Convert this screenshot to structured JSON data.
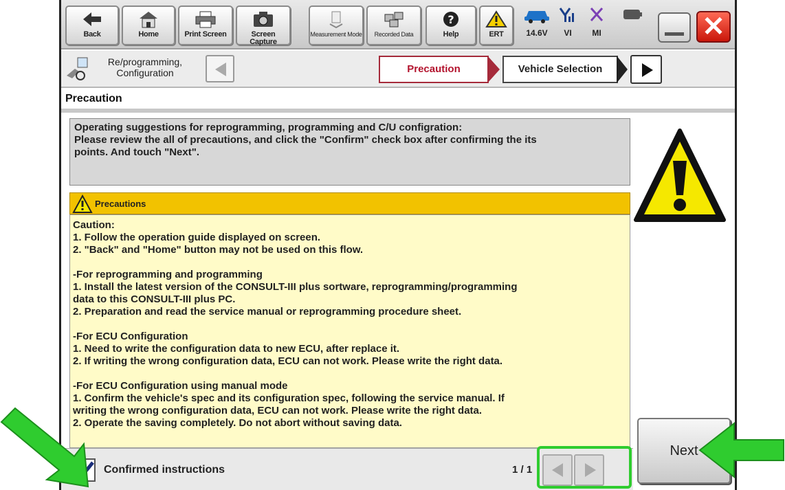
{
  "toolbar": {
    "buttons": [
      {
        "label": "Back",
        "icon": "back-arrow-icon"
      },
      {
        "label": "Home",
        "icon": "home-icon"
      },
      {
        "label": "Print Screen",
        "icon": "printer-icon"
      },
      {
        "label": "Screen Capture",
        "icon": "camera-icon"
      },
      {
        "label": "Measurement Mode",
        "icon": "measurement-icon"
      },
      {
        "label": "Recorded Data",
        "icon": "recorded-data-icon"
      },
      {
        "label": "Help",
        "icon": "help-icon"
      },
      {
        "label": "ERT",
        "icon": "warning-icon"
      }
    ],
    "status": {
      "voltage": "14.6V",
      "vi": "VI",
      "mi": "MI"
    }
  },
  "nav": {
    "title": "Re/programming, Configuration",
    "steps": [
      "Precaution",
      "Vehicle Selection"
    ]
  },
  "section_title": "Precaution",
  "info_text": [
    "Operating suggestions for reprogramming, programming and C/U configration:",
    "Please review the all of precautions, and click the \"Confirm\" check box after confirming the its",
    "points. And touch \"Next\"."
  ],
  "precautions": {
    "header": "Precautions",
    "lines": [
      "Caution:",
      "1. Follow the operation guide displayed on screen.",
      "2. \"Back\" and  \"Home\" button may not be used on this flow.",
      "",
      "-For reprogramming and programming",
      "1. Install the latest version of the CONSULT-III plus sortware, reprogramming/programming",
      "data to this CONSULT-III plus PC.",
      "2. Preparation and read the service manual or reprogramming procedure sheet.",
      "",
      "-For ECU Configuration",
      "1. Need to write the configuration data to new ECU, after replace it.",
      "2. If writing the wrong configuration data, ECU can not work. Please write the right data.",
      "",
      "-For ECU Configuration using manual mode",
      "1. Confirm the vehicle's spec and its configuration spec, following the service manual.  If",
      "writing the wrong configuration data, ECU can not work. Please write the right data.",
      "2. Operate the saving completely.  Do not abort without saving data."
    ]
  },
  "footer": {
    "confirm_label": "Confirmed instructions",
    "confirm_checked": true,
    "page": "1 / 1"
  },
  "next_label": "Next",
  "colors": {
    "precaution_header": "#f2c200",
    "precaution_body": "#fffbc8",
    "active_step": "#b3142e",
    "annotation_green": "#2fcc2f"
  }
}
